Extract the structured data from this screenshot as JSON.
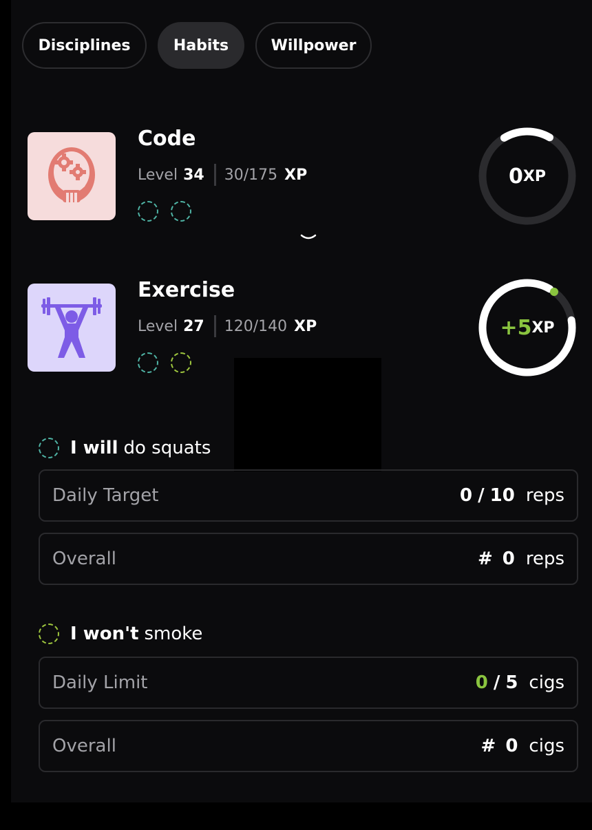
{
  "tabs": [
    {
      "label": "Disciplines",
      "active": false
    },
    {
      "label": "Habits",
      "active": true
    },
    {
      "label": "Willpower",
      "active": false
    }
  ],
  "cards": [
    {
      "title": "Code",
      "level_label": "Level",
      "level": "34",
      "xp_progress": "30/175",
      "xp_unit": "XP",
      "icon": "robot-gear-icon",
      "ring_value": "0",
      "ring_unit": "XP",
      "ring_fill_fraction": 0.17
    },
    {
      "title": "Exercise",
      "level_label": "Level",
      "level": "27",
      "xp_progress": "120/140",
      "xp_unit": "XP",
      "icon": "weightlifter-icon",
      "ring_value": "+5",
      "ring_unit": "XP",
      "ring_fill_fraction": 0.86
    }
  ],
  "habits": [
    {
      "prefix": "I will",
      "text": "do squats",
      "rows": [
        {
          "label": "Daily Target",
          "current": "0",
          "separator": "/",
          "target": "10",
          "unit": "reps"
        },
        {
          "label": "Overall",
          "symbol": "#",
          "value": "0",
          "unit": "reps"
        }
      ]
    },
    {
      "prefix": "I won't",
      "text": "smoke",
      "rows": [
        {
          "label": "Daily Limit",
          "current": "0",
          "separator": "/",
          "target": "5",
          "unit": "cigs"
        },
        {
          "label": "Overall",
          "symbol": "#",
          "value": "0",
          "unit": "cigs"
        }
      ]
    }
  ],
  "colors": {
    "teal_dot": "#4fb3a4",
    "green_accent": "#8ac43f",
    "code_tile": "#f6dcdc",
    "exercise_tile": "#ddd6fb"
  }
}
